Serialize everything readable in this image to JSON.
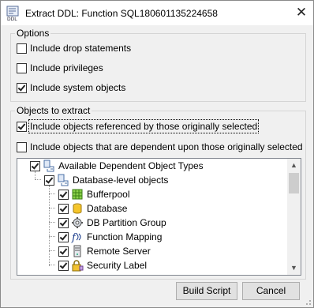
{
  "title": "Extract DDL: Function SQL180601135224658",
  "options": {
    "legend": "Options",
    "drop": {
      "label": "Include drop statements",
      "checked": false
    },
    "privileges": {
      "label": "Include privileges",
      "checked": false
    },
    "system": {
      "label": "Include system objects",
      "checked": true
    }
  },
  "objects": {
    "legend": "Objects to extract",
    "referenced": {
      "label": "Include objects referenced by those originally selected",
      "checked": true
    },
    "dependent": {
      "label": "Include objects that are dependent upon those originally selected",
      "checked": false
    }
  },
  "tree": {
    "root": "Available Dependent Object Types",
    "db_level": "Database-level objects",
    "items": [
      "Bufferpool",
      "Database",
      "DB Partition Group",
      "Function Mapping",
      "Remote Server",
      "Security Label"
    ]
  },
  "buttons": {
    "build": "Build Script",
    "cancel": "Cancel"
  }
}
